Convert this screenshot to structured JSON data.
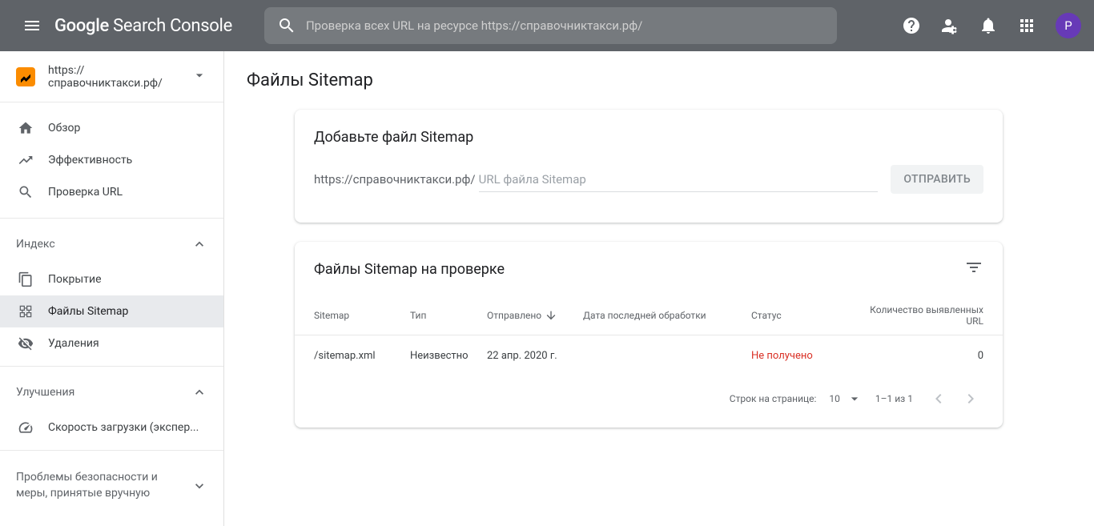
{
  "header": {
    "search_placeholder": "Проверка всех URL на ресурсе https://справочниктакси.рф/",
    "avatar_letter": "P"
  },
  "property": {
    "url": "https://справочниктакси.рф/"
  },
  "nav": {
    "overview": "Обзор",
    "performance": "Эффективность",
    "url_inspection": "Проверка URL",
    "section_index": "Индекс",
    "coverage": "Покрытие",
    "sitemaps": "Файлы Sitemap",
    "removals": "Удаления",
    "section_enhancements": "Улучшения",
    "speed": "Скорость загрузки (экспер...",
    "section_security": "Проблемы безопасности и меры, принятые вручную"
  },
  "page": {
    "title": "Файлы Sitemap"
  },
  "add_card": {
    "title": "Добавьте файл Sitemap",
    "prefix": "https://справочниктакси.рф/",
    "placeholder": "URL файла Sitemap",
    "submit": "ОТПРАВИТЬ"
  },
  "table_card": {
    "title": "Файлы Sitemap на проверке",
    "columns": {
      "sitemap": "Sitemap",
      "type": "Тип",
      "sent": "Отправлено",
      "processed": "Дата последней обработки",
      "status": "Статус",
      "url_count": "Количество выявленных URL"
    },
    "rows": [
      {
        "sitemap": "/sitemap.xml",
        "type": "Неизвестно",
        "sent": "22 апр. 2020 г.",
        "processed": "",
        "status": "Не получено",
        "url_count": "0"
      }
    ],
    "pagination": {
      "rows_label": "Строк на странице:",
      "rows_value": "10",
      "range": "1–1 из 1"
    }
  }
}
